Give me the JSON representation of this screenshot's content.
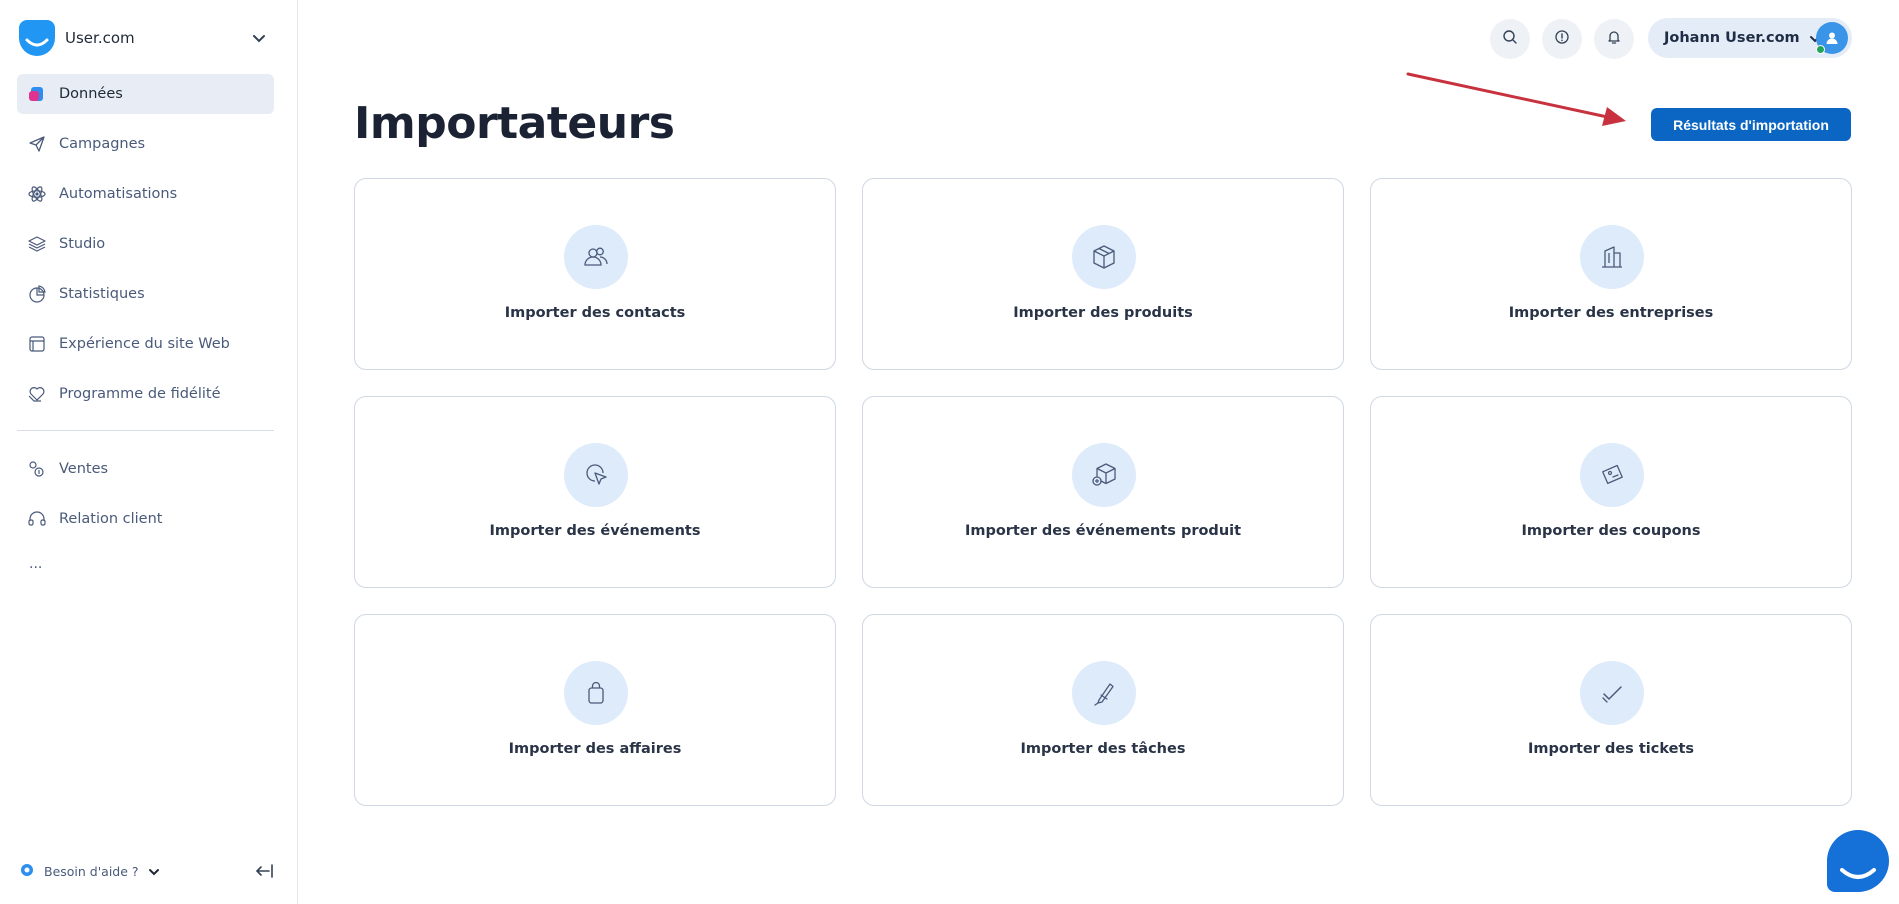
{
  "brand": {
    "name": "User.com"
  },
  "sidebar": {
    "items": [
      {
        "label": "Données",
        "icon": "data-icon",
        "active": true
      },
      {
        "label": "Campagnes",
        "icon": "paper-plane-icon"
      },
      {
        "label": "Automatisations",
        "icon": "atom-icon"
      },
      {
        "label": "Studio",
        "icon": "layers-icon"
      },
      {
        "label": "Statistiques",
        "icon": "pie-chart-icon"
      },
      {
        "label": "Expérience du site Web",
        "icon": "browser-window-icon"
      },
      {
        "label": "Programme de fidélité",
        "icon": "heart-hand-icon"
      }
    ],
    "secondary_items": [
      {
        "label": "Ventes",
        "icon": "sales-icon"
      },
      {
        "label": "Relation client",
        "icon": "headset-icon"
      }
    ],
    "more_label": "...",
    "help_label": "Besoin d'aide ?"
  },
  "topbar": {
    "user_name": "Johann User.com"
  },
  "page": {
    "title": "Importateurs",
    "primary_button_label": "Résultats d'importation"
  },
  "importers": [
    {
      "label": "Importer des contacts",
      "icon": "contacts-icon"
    },
    {
      "label": "Importer des produits",
      "icon": "box-icon"
    },
    {
      "label": "Importer des entreprises",
      "icon": "building-icon"
    },
    {
      "label": "Importer des événements",
      "icon": "cursor-click-icon"
    },
    {
      "label": "Importer des événements produit",
      "icon": "box-click-icon"
    },
    {
      "label": "Importer des coupons",
      "icon": "coupon-icon"
    },
    {
      "label": "Importer des affaires",
      "icon": "shopping-bag-icon"
    },
    {
      "label": "Importer des tâches",
      "icon": "pen-icon"
    },
    {
      "label": "Importer des tickets",
      "icon": "checkmark-ticket-icon"
    }
  ],
  "colors": {
    "primary": "#0a66c2",
    "card_border": "#cfd8e3",
    "icon_bg": "#deebfa",
    "annotation_arrow": "#c8323f"
  }
}
